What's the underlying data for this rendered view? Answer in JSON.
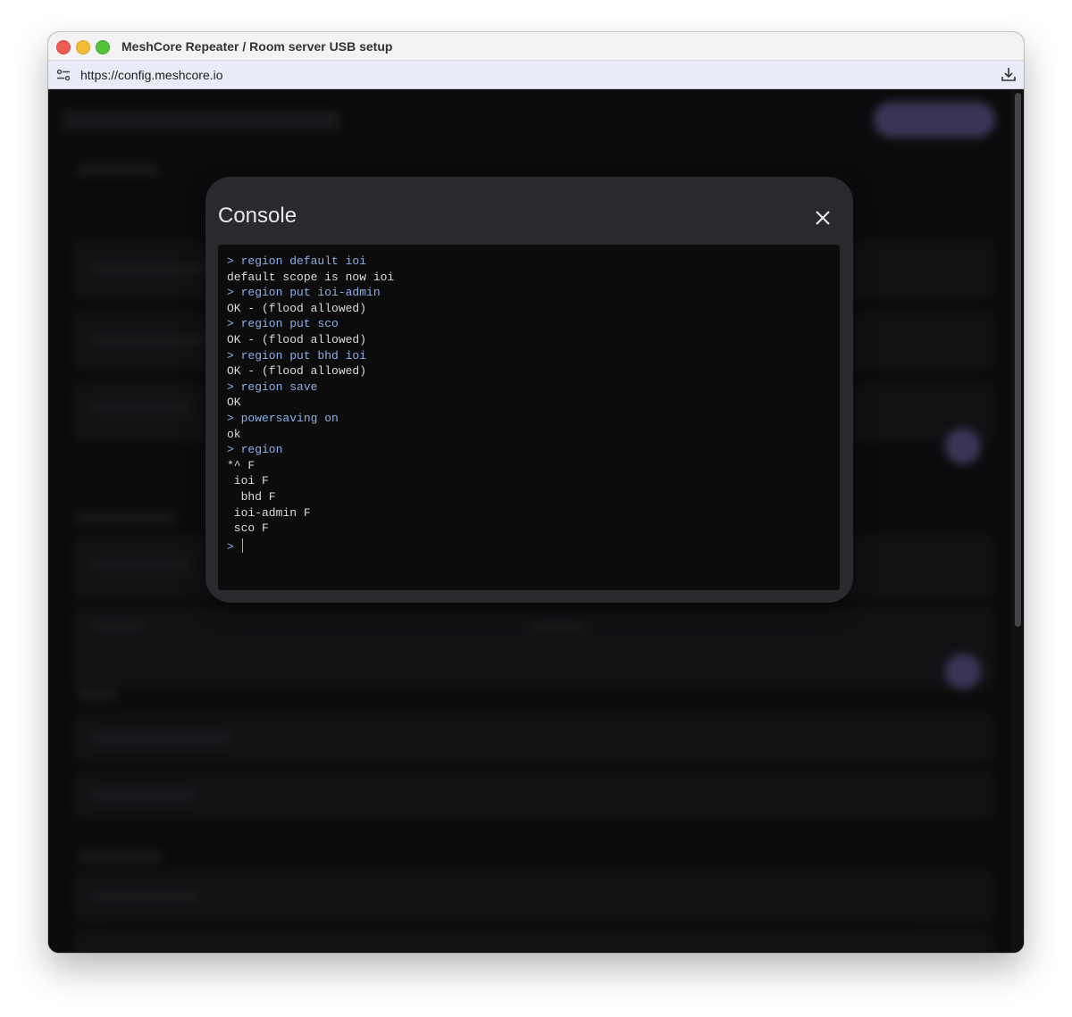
{
  "window": {
    "title": "MeshCore Repeater / Room server USB setup"
  },
  "browser": {
    "url": "https://config.meshcore.io",
    "site_info_icon": "tune-icon",
    "download_icon": "download-icon"
  },
  "colors": {
    "dialog_bg": "#2a292e",
    "console_bg": "#0c0c0d",
    "command_text": "#8ab0e8",
    "output_text": "#dcdcdc",
    "accent": "#9a86e0"
  },
  "dialog": {
    "title": "Console",
    "close_icon": "close-icon"
  },
  "console": {
    "lines": [
      {
        "type": "cmd",
        "text": "> region default ioi"
      },
      {
        "type": "out",
        "text": "default scope is now ioi"
      },
      {
        "type": "cmd",
        "text": "> region put ioi-admin"
      },
      {
        "type": "out",
        "text": "OK - (flood allowed)"
      },
      {
        "type": "cmd",
        "text": "> region put sco"
      },
      {
        "type": "out",
        "text": "OK - (flood allowed)"
      },
      {
        "type": "cmd",
        "text": "> region put bhd ioi"
      },
      {
        "type": "out",
        "text": "OK - (flood allowed)"
      },
      {
        "type": "cmd",
        "text": "> region save"
      },
      {
        "type": "out",
        "text": "OK"
      },
      {
        "type": "cmd",
        "text": "> powersaving on"
      },
      {
        "type": "out",
        "text": "ok"
      },
      {
        "type": "cmd",
        "text": "> region"
      },
      {
        "type": "out",
        "text": "*^ F"
      },
      {
        "type": "out",
        "text": " ioi F"
      },
      {
        "type": "out",
        "text": "  bhd F"
      },
      {
        "type": "out",
        "text": " ioi-admin F"
      },
      {
        "type": "out",
        "text": " sco F"
      }
    ],
    "prompt": "> "
  }
}
